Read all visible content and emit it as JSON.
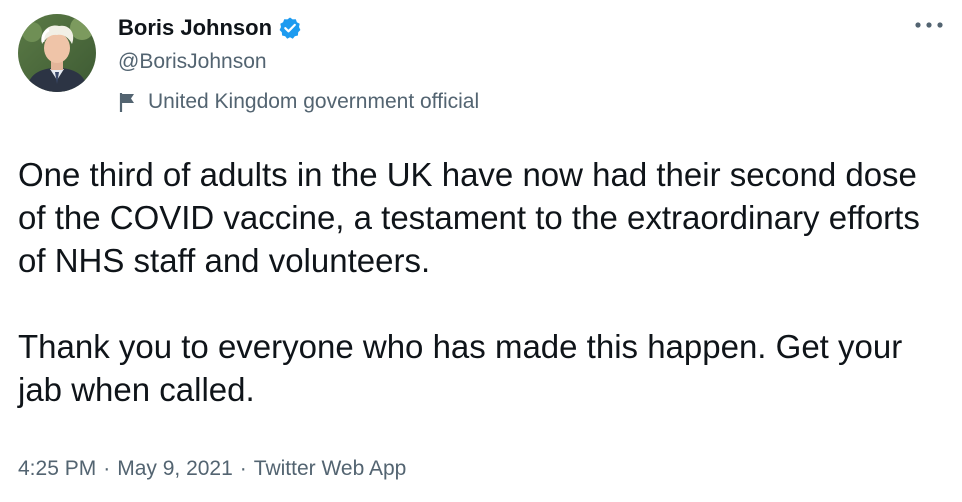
{
  "author": {
    "display_name": "Boris Johnson",
    "handle": "@BorisJohnson",
    "verified": true,
    "avatar_icon": "profile-photo",
    "label": "United Kingdom government official",
    "label_icon": "flag-icon"
  },
  "tweet": {
    "paragraph1": "One third of adults in the UK have now had their second dose of the COVID vaccine, a testament to the extraordinary efforts of NHS staff and volunteers.",
    "paragraph2": "Thank you to everyone who has made this happen. Get your jab when called."
  },
  "meta": {
    "time": "4:25 PM",
    "separator": "·",
    "date": "May 9, 2021",
    "source": "Twitter Web App"
  },
  "colors": {
    "text_primary": "#0f1419",
    "text_secondary": "#536471",
    "verified_blue": "#1d9bf0"
  },
  "icons": {
    "more": "more-icon",
    "verified": "verified-badge-icon"
  }
}
